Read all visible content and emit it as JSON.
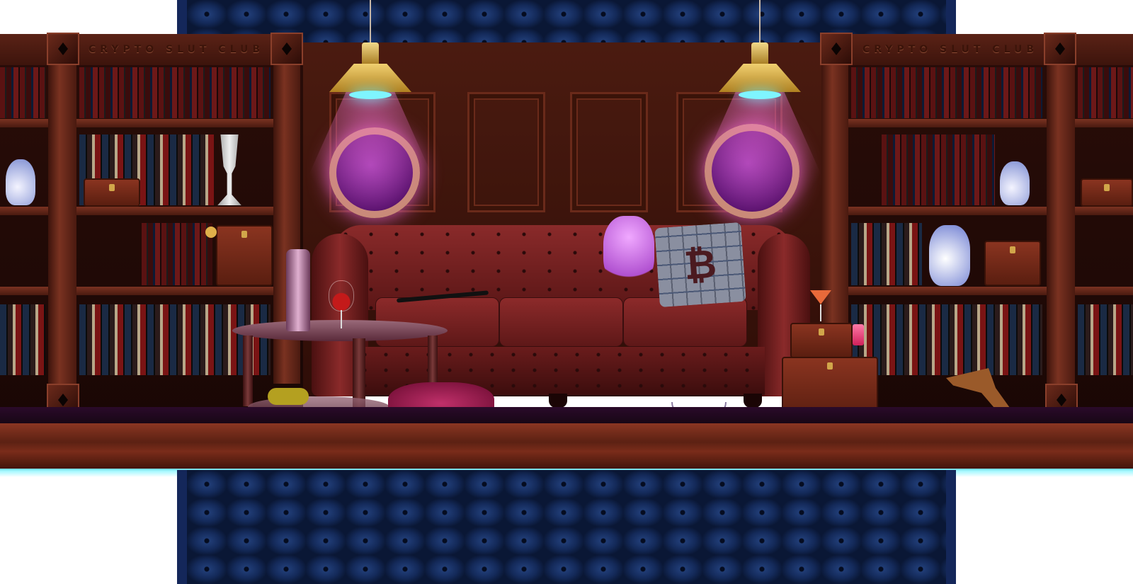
{
  "scene": {
    "signs": {
      "left": "CRYPTO SLUT CLUB",
      "right": "CRYPTO SLUT CLUB"
    },
    "pillow_symbol": "₿",
    "accent_colors": {
      "neon_cyan": "#7ff5ff",
      "magenta_light": "#e060c0",
      "quilt_blue": "#142a5a",
      "wood": "#5a2216",
      "leather": "#8a2a2a"
    }
  }
}
